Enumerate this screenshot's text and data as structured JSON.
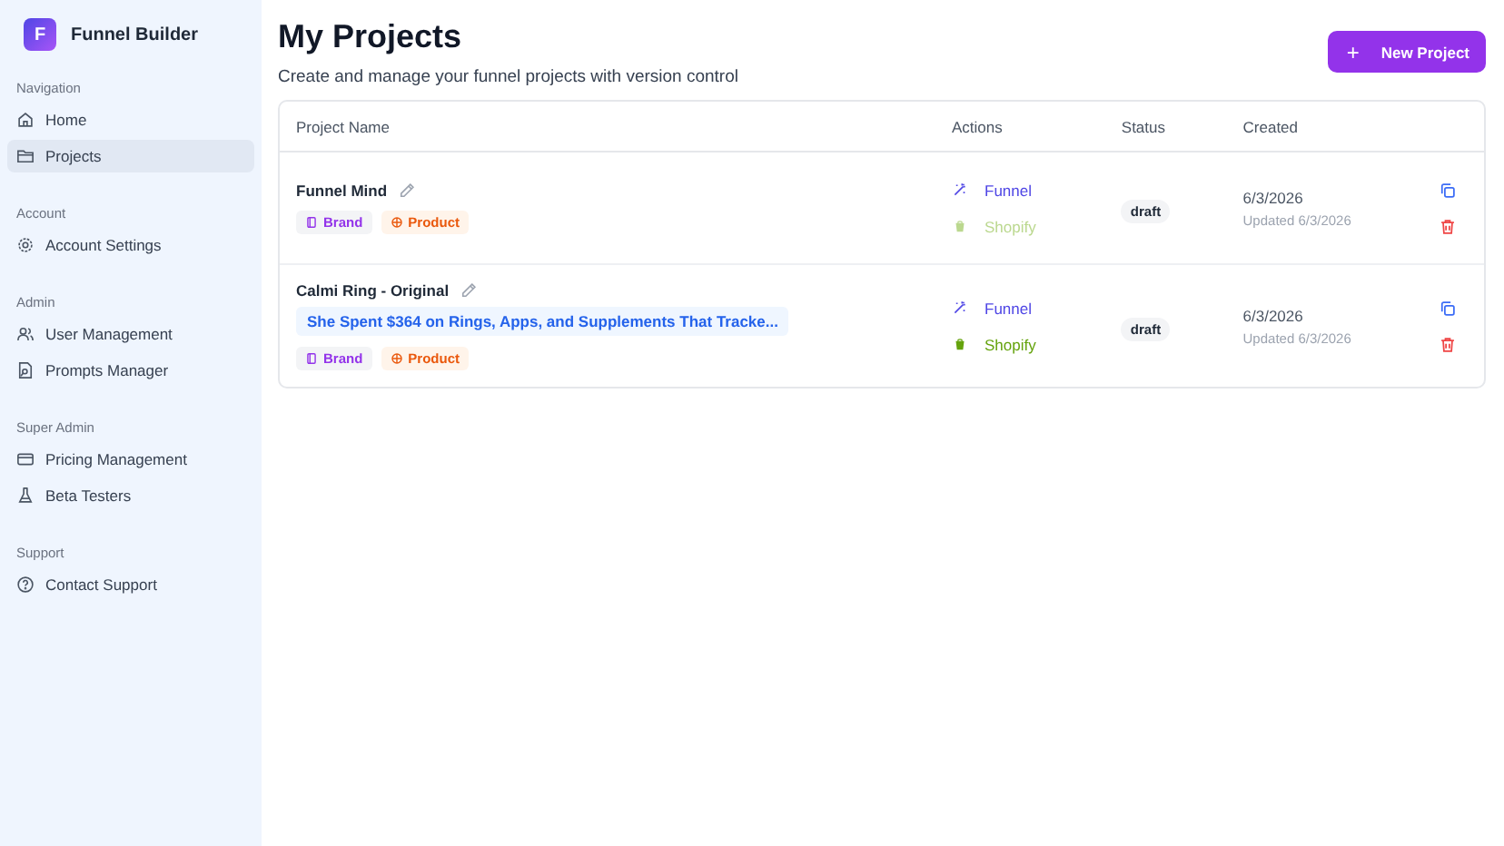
{
  "app": {
    "logo": "F",
    "name": "Funnel Builder"
  },
  "sidebar": {
    "sections": [
      {
        "title": "Navigation",
        "items": [
          {
            "label": "Home",
            "selected": false
          },
          {
            "label": "Projects",
            "selected": true
          }
        ]
      },
      {
        "title": "Account",
        "items": [
          {
            "label": "Account Settings",
            "selected": false
          }
        ]
      },
      {
        "title": "Admin",
        "items": [
          {
            "label": "User Management",
            "selected": false
          },
          {
            "label": "Prompts Manager",
            "selected": false
          }
        ]
      },
      {
        "title": "Super Admin",
        "items": [
          {
            "label": "Pricing Management",
            "selected": false
          },
          {
            "label": "Beta Testers",
            "selected": false
          }
        ]
      },
      {
        "title": "Support",
        "items": [
          {
            "label": "Contact Support",
            "selected": false
          }
        ]
      }
    ]
  },
  "header": {
    "title": "My Projects",
    "subtitle": "Create and manage your funnel projects with version control",
    "button": "New Project",
    "button_icon": "+"
  },
  "table": {
    "columns": [
      "Project Name",
      "Actions",
      "Status",
      "Created"
    ],
    "rows": [
      {
        "name": "Funnel Mind",
        "headline": null,
        "tags": [
          "Brand",
          "Product"
        ],
        "funnel": "Funnel",
        "shopify": "Shopify",
        "shopify_disabled": true,
        "status": "draft",
        "created": "6/3/2026",
        "updated": "Updated 6/3/2026"
      },
      {
        "name": "Calmi Ring - Original",
        "headline": "She Spent $364 on Rings, Apps, and Supplements That Tracke...",
        "tags": [
          "Brand",
          "Product"
        ],
        "funnel": "Funnel",
        "shopify": "Shopify",
        "shopify_disabled": false,
        "status": "draft",
        "created": "6/3/2026",
        "updated": "Updated 6/3/2026"
      }
    ]
  }
}
